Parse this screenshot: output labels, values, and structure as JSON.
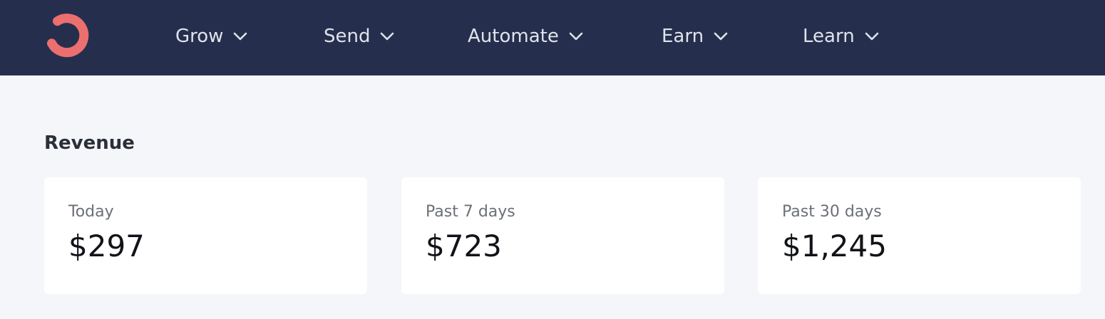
{
  "brand": {
    "logo_icon": "brand-ring-icon",
    "logo_color": "#ec6f6f",
    "nav_background": "#252f4d"
  },
  "nav": {
    "items": [
      {
        "label": "Grow",
        "icon": "chevron-down-icon"
      },
      {
        "label": "Send",
        "icon": "chevron-down-icon"
      },
      {
        "label": "Automate",
        "icon": "chevron-down-icon"
      },
      {
        "label": "Earn",
        "icon": "chevron-down-icon"
      },
      {
        "label": "Learn",
        "icon": "chevron-down-icon"
      }
    ]
  },
  "revenue": {
    "title": "Revenue",
    "cards": [
      {
        "label": "Today",
        "value": "$297"
      },
      {
        "label": "Past 7 days",
        "value": "$723"
      },
      {
        "label": "Past 30 days",
        "value": "$1,245"
      }
    ]
  }
}
